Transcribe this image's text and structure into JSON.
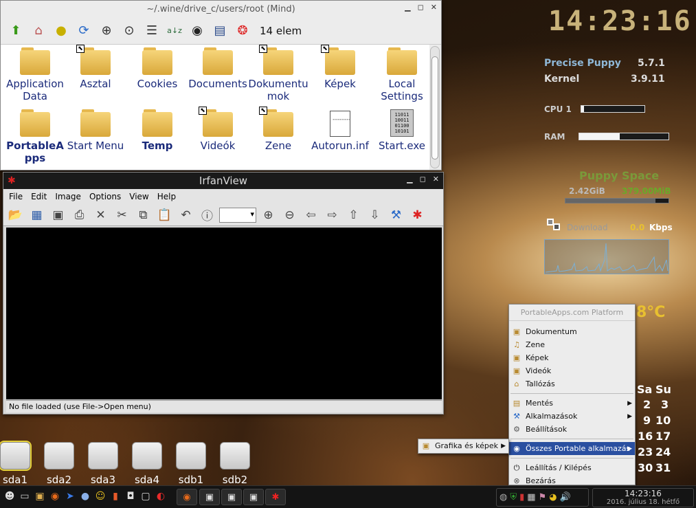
{
  "conky": {
    "clock": "14:23:16",
    "distro_label": "Precise Puppy",
    "distro_version": "5.7.1",
    "kernel_label": "Kernel",
    "kernel_version": "3.9.11",
    "cpu_label": "CPU 1",
    "cpu_level": 0.04,
    "ram_label": "RAM",
    "ram_level": 0.45,
    "space_title": "Puppy Space",
    "space_used": "2.42GiB",
    "space_free": "379.00MiB",
    "space_level": 0.87,
    "download_label": "Download",
    "download_value": "0.0",
    "download_unit": "Kbps",
    "temp": "8°C",
    "cal_headers": [
      "Sa",
      "Su"
    ],
    "cal_rows": [
      [
        "2",
        "3"
      ],
      [
        "9",
        "10"
      ],
      [
        "16",
        "17"
      ],
      [
        "23",
        "24"
      ],
      [
        "30",
        "31"
      ]
    ]
  },
  "filer": {
    "title": "~/.wine/drive_c/users/root (Mind)",
    "item_count": "14 elem",
    "toolbar_icons": [
      "up-icon",
      "home-icon",
      "bookmark-icon",
      "refresh-icon",
      "zoom-in-icon",
      "zoom-fit-icon",
      "details-icon",
      "sort-icon",
      "show-hidden-icon",
      "select-icon",
      "help-icon"
    ],
    "items": [
      {
        "label": "Application Data",
        "type": "folder",
        "link": false,
        "bold": false
      },
      {
        "label": "Asztal",
        "type": "folder",
        "link": true,
        "bold": false
      },
      {
        "label": "Cookies",
        "type": "folder",
        "link": false,
        "bold": false
      },
      {
        "label": "Documents",
        "type": "folder",
        "link": false,
        "bold": false
      },
      {
        "label": "Dokumentu mok",
        "type": "folder",
        "link": true,
        "bold": false
      },
      {
        "label": "Képek",
        "type": "folder",
        "link": true,
        "bold": false
      },
      {
        "label": "Local Settings",
        "type": "folder",
        "link": false,
        "bold": false
      },
      {
        "label": "PortableA pps",
        "type": "folder",
        "link": false,
        "bold": true
      },
      {
        "label": "Start Menu",
        "type": "folder",
        "link": false,
        "bold": false
      },
      {
        "label": "Temp",
        "type": "folder",
        "link": false,
        "bold": true
      },
      {
        "label": "Videók",
        "type": "folder",
        "link": true,
        "bold": false
      },
      {
        "label": "Zene",
        "type": "folder",
        "link": true,
        "bold": false
      },
      {
        "label": "Autorun.inf",
        "type": "doc",
        "link": false,
        "bold": false
      },
      {
        "label": "Start.exe",
        "type": "exe",
        "link": false,
        "bold": false
      }
    ]
  },
  "irfan": {
    "title": "IrfanView",
    "menu": [
      "File",
      "Edit",
      "Image",
      "Options",
      "View",
      "Help"
    ],
    "status": "No file loaded (use File->Open menu)"
  },
  "drives": [
    "sda1",
    "sda2",
    "sda3",
    "sda4",
    "sdb1",
    "sdb2"
  ],
  "portable_menu": {
    "header": "PortableApps.com Platform",
    "group1": [
      "Dokumentum",
      "Zene",
      "Képek",
      "Videók",
      "Tallózás"
    ],
    "group2": [
      "Mentés",
      "Alkalmazások",
      "Beállítások"
    ],
    "active": "Összes Portable alkalmazás",
    "group3": [
      "Leállítás / Kilépés",
      "Bezárás"
    ]
  },
  "sub_menu": {
    "label": "Grafika és képek"
  },
  "taskbar": {
    "time": "14:23:16",
    "date": "2016. július 18. hétfő"
  }
}
